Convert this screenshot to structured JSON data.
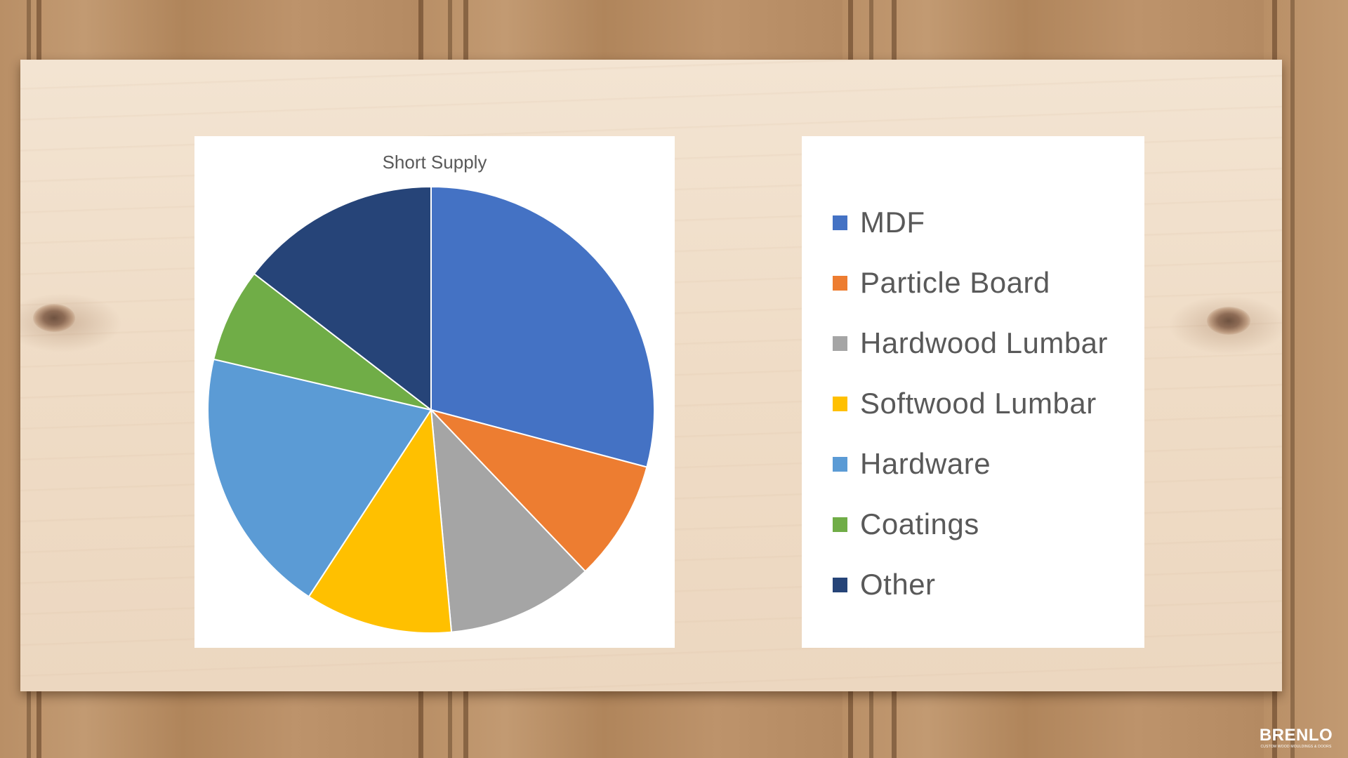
{
  "chart_data": {
    "type": "pie",
    "title": "Short Supply",
    "categories": [
      "MDF",
      "Particle Board",
      "Hardwood Lumbar",
      "Softwood Lumbar",
      "Hardware",
      "Coatings",
      "Other"
    ],
    "values": [
      30,
      9,
      11,
      11,
      20,
      7,
      15
    ],
    "colors": [
      "#4472C4",
      "#ED7D31",
      "#A5A5A5",
      "#FFC000",
      "#5B9BD5",
      "#70AD47",
      "#264478"
    ],
    "legend": "right"
  },
  "logo": {
    "word": "BRENLO",
    "tagline": "CUSTOM WOOD MOULDINGS & DOORS"
  }
}
